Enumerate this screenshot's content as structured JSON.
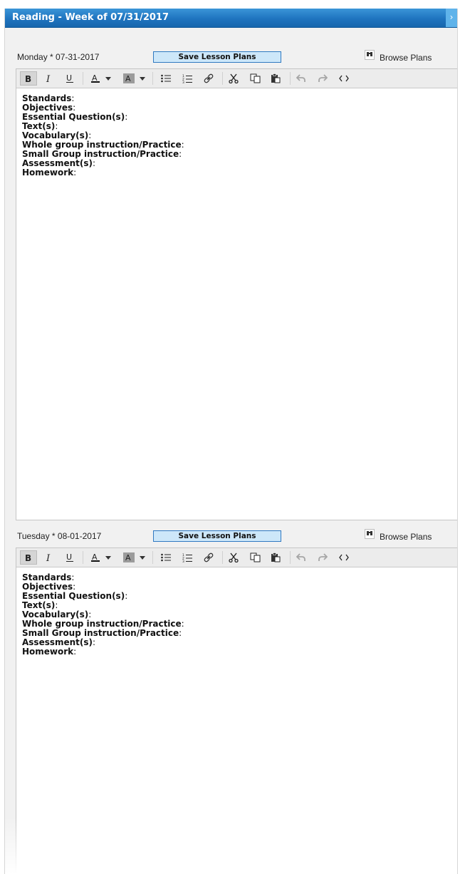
{
  "panel": {
    "title": "Reading - Week of 07/31/2017",
    "collapse_glyph": "›"
  },
  "colors": {
    "title_bar": "#1f74bf",
    "save_button_bg": "#cde7f9",
    "save_button_border": "#2f79c1"
  },
  "days": [
    {
      "date": "Monday * 07-31-2017",
      "save_label": "Save Lesson Plans",
      "browse_label": "Browse Plans",
      "lines": [
        {
          "label": "Standards",
          "sep": ":"
        },
        {
          "label": "Objectives",
          "sep": ":"
        },
        {
          "label": "Essential Question(s)",
          "sep": ":"
        },
        {
          "label": "Text(s)",
          "sep": ":"
        },
        {
          "label": "Vocabulary(s)",
          "sep": ":"
        },
        {
          "label": "Whole group instruction/Practice",
          "sep": ":"
        },
        {
          "label": "Small Group instruction/Practice",
          "sep": ":"
        },
        {
          "label": "Assessment(s)",
          "sep": ":"
        },
        {
          "label": "Homework",
          "sep": ":"
        }
      ]
    },
    {
      "date": "Tuesday * 08-01-2017",
      "save_label": "Save Lesson Plans",
      "browse_label": "Browse Plans",
      "lines": [
        {
          "label": "Standards",
          "sep": ":"
        },
        {
          "label": "Objectives",
          "sep": ":"
        },
        {
          "label": "Essential Question(s)",
          "sep": ":"
        },
        {
          "label": "Text(s)",
          "sep": ":"
        },
        {
          "label": "Vocabulary(s)",
          "sep": ":"
        },
        {
          "label": "Whole group instruction/Practice",
          "sep": ":"
        },
        {
          "label": "Small Group instruction/Practice",
          "sep": ":"
        },
        {
          "label": "Assessment(s)",
          "sep": ":"
        },
        {
          "label": "Homework",
          "sep": ":"
        }
      ]
    }
  ],
  "toolbar_icons": [
    "bold-icon",
    "italic-icon",
    "underline-icon",
    "font-color-icon",
    "font-color-dropdown-icon",
    "highlight-color-icon",
    "highlight-color-dropdown-icon",
    "bulleted-list-icon",
    "numbered-list-icon",
    "link-icon",
    "cut-icon",
    "copy-icon",
    "paste-icon",
    "undo-icon",
    "redo-icon",
    "source-code-icon"
  ]
}
